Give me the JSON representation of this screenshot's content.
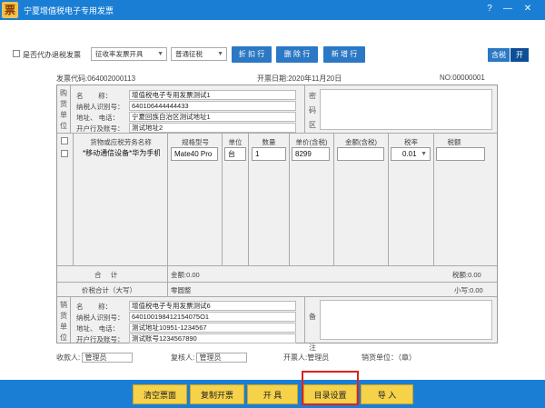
{
  "window": {
    "logo_char": "票",
    "title": "宁夏增值税电子专用发票",
    "controls": {
      "help": "?",
      "minimize": "—",
      "close": "✕"
    }
  },
  "toolbar": {
    "proxy_refund_label": "是否代办退税发票",
    "issue_type": "征收率发票开具",
    "tax_type": "普通征税",
    "discount_btn": "折 扣 行",
    "delete_btn": "删 除 行",
    "add_btn": "新 增 行",
    "tax_incl_off": "含税",
    "tax_incl_on": "开"
  },
  "header": {
    "invoice_code": "发票代码:064002000113",
    "issue_date": "开票日期:2020年11月20日",
    "invoice_no": "NO:00000001"
  },
  "buyer": {
    "side_label": [
      "购",
      "货",
      "单",
      "位"
    ],
    "name_label": "名        称：",
    "name": "增值税电子专用发票测试1",
    "tax_id_label": "纳税人识别号：",
    "tax_id": "640106444444433",
    "addr_label": "地址、 电话：",
    "addr": "宁夏回族自治区测试地址1",
    "bank_label": "开户行及账号：",
    "bank": "测试地址2",
    "cipher_label": [
      "密",
      "码",
      "区"
    ]
  },
  "items": {
    "headers": [
      "货物或应税劳务名称",
      "规格型号",
      "单位",
      "数量",
      "单价(含税)",
      "金额(含税)",
      "税率",
      "税额"
    ],
    "row": {
      "name": "*移动通信设备*华为手机",
      "spec": "Mate40 Pro",
      "unit": "台",
      "qty": "1",
      "price": "8299",
      "amount": "",
      "rate": "0.01",
      "tax": ""
    }
  },
  "totals": {
    "total_label": "合     计",
    "amount": "金额:0.00",
    "tax": "税额:0.00",
    "capital_label": "价税合计（大写）",
    "capital": "零圆整",
    "small": "小写:0.00"
  },
  "seller": {
    "side_label": [
      "销",
      "货",
      "单",
      "位"
    ],
    "name_label": "名        称：",
    "name": "增值税电子专用发票测试6",
    "tax_id_label": "纳税人识别号：",
    "tax_id": "640100198412154075O1",
    "addr_label": "地址、 电话：",
    "addr": "测试地址10951-1234567",
    "bank_label": "开户行及账号：",
    "bank": "测试账号1234567890",
    "remark_label": [
      "备",
      "注"
    ]
  },
  "footer": {
    "payee_label": "收款人:",
    "payee": "管理员",
    "reviewer_label": "复核人:",
    "reviewer": "管理员",
    "drawer": "开票人:管理员",
    "seal": "销货单位：（章）"
  },
  "actions": {
    "clear": "清空票面",
    "copy": "复制开票",
    "issue": "开 具",
    "catalog": "目录设置",
    "import": "导 入"
  },
  "colors": {
    "titlebar": "#1a7fd4",
    "button": "#2b78c4",
    "action": "#f5d24a",
    "highlight": "#e02020"
  }
}
